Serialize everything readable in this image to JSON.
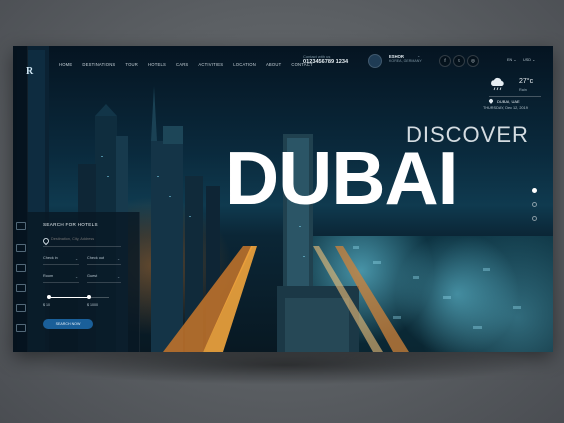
{
  "logo": "R",
  "nav": {
    "items": [
      "HOME",
      "DESTINATIONS",
      "TOUR",
      "HOTELS",
      "CARS",
      "ACTIVITIES",
      "LOCATION",
      "ABOUT",
      "CONTACT"
    ]
  },
  "contact": {
    "label": "Contact with us",
    "phone": "0123456789 1234"
  },
  "user": {
    "name": "ESHOR",
    "location": "KOREA, GERMANY",
    "caret": "⌄"
  },
  "social": {
    "facebook": "f",
    "twitter": "t",
    "instagram": "◎"
  },
  "language": "EN  ⌄",
  "currency": "USD  ⌄",
  "weather": {
    "temperature": "27°c",
    "condition": "Rain",
    "city": "DUBAI, UAE",
    "date": "THURSDAY, Dec 12, 2019"
  },
  "headline": {
    "discover": "DISCOVER",
    "title": "DUBAI"
  },
  "search_panel": {
    "title": "SEARCH FOR HOTELS",
    "destination_placeholder": "Destination, City, Address",
    "check_in": "Check in",
    "check_out": "Check out",
    "room": "Room",
    "guest": "Guest",
    "caret": "⌄",
    "price_min": "$ 10",
    "price_max": "$ 1000",
    "search_button": "SEARCH NOW"
  },
  "colors": {
    "accent": "#1a5f99",
    "panel_bg": "#081824",
    "text": "#ffffff"
  }
}
